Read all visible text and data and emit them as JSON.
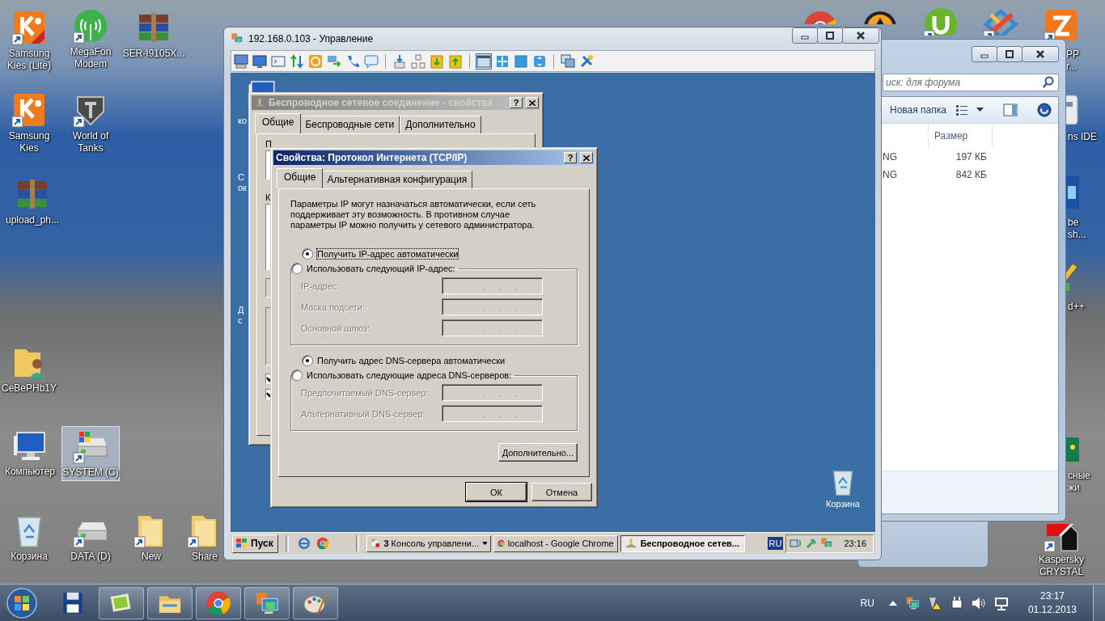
{
  "desktop_icons": [
    {
      "kind": "kies-lite",
      "label": "Samsung Kies (Lite)",
      "shortcut": true,
      "selected": false
    },
    {
      "kind": "modem",
      "label": "MegaFon Modem",
      "shortcut": true,
      "selected": false
    },
    {
      "kind": "archive",
      "label": "SER-I9105X...",
      "shortcut": false,
      "selected": false
    },
    {
      "kind": "kies",
      "label": "Samsung Kies",
      "shortcut": true,
      "selected": false
    },
    {
      "kind": "tanks",
      "label": "World of Tanks",
      "shortcut": true,
      "selected": false
    },
    {
      "kind": "archive",
      "label": "upload_ph...",
      "shortcut": false,
      "selected": false
    },
    {
      "kind": "user-folder",
      "label": "CeBePHb1Y",
      "shortcut": false,
      "selected": false
    },
    {
      "kind": "computer",
      "label": "Компьютер",
      "shortcut": false,
      "selected": false
    },
    {
      "kind": "system-drive",
      "label": "SYSTEM (C)",
      "shortcut": true,
      "selected": true
    },
    {
      "kind": "recycle-bin",
      "label": "Корзина",
      "shortcut": false,
      "selected": false
    },
    {
      "kind": "drive",
      "label": "DATA (D)",
      "shortcut": true,
      "selected": false
    },
    {
      "kind": "folder",
      "label": "New",
      "shortcut": true,
      "selected": false
    },
    {
      "kind": "folder",
      "label": "Share",
      "shortcut": true,
      "selected": false
    },
    {
      "kind": "chrome"
    },
    {
      "kind": "game"
    },
    {
      "kind": "torrent",
      "shortcut": true
    },
    {
      "kind": "studio",
      "shortcut": true
    },
    {
      "kind": "xampp",
      "label": "PP\nr...",
      "shortcut": true
    },
    {
      "kind": "ide",
      "label": "ns IDE"
    },
    {
      "kind": "photoshop",
      "label": "be\nsh..."
    },
    {
      "kind": "notepad",
      "label": "d++"
    },
    {
      "kind": "green-app",
      "label": "сные\nжи"
    },
    {
      "kind": "kaspersky",
      "label": "Kaspersky\nCRYSTAL",
      "shortcut": true,
      "selected": false
    }
  ],
  "explorer": {
    "search_placeholder": "иск: для форума",
    "new_folder": "Новая папка",
    "columns": [
      "Размер"
    ],
    "rows": [
      {
        "name": "NG",
        "size": "197 КБ"
      },
      {
        "name": "NG",
        "size": "842 КБ"
      }
    ]
  },
  "remote_window": {
    "title": "192.168.0.103 - Управление",
    "toolbar": [
      {
        "kind": "monitor-keyboard",
        "pressed": false
      },
      {
        "kind": "monitor",
        "pressed": false
      },
      {
        "kind": "terminal",
        "pressed": false
      },
      {
        "kind": "transfer",
        "pressed": false
      },
      {
        "kind": "power",
        "pressed": false
      },
      {
        "kind": "chat-arrows",
        "pressed": false
      },
      {
        "kind": "phone",
        "pressed": false
      },
      {
        "kind": "chat",
        "pressed": false
      },
      {
        "kind": "separator"
      },
      {
        "kind": "download",
        "pressed": false
      },
      {
        "kind": "network",
        "pressed": false
      },
      {
        "kind": "clipboard-down",
        "pressed": false
      },
      {
        "kind": "clipboard-up",
        "pressed": false
      },
      {
        "kind": "separator"
      },
      {
        "kind": "window",
        "pressed": true
      },
      {
        "kind": "fit",
        "pressed": false
      },
      {
        "kind": "square",
        "pressed": false
      },
      {
        "kind": "circle-arrows",
        "pressed": false
      },
      {
        "kind": "separator"
      },
      {
        "kind": "windows",
        "pressed": false
      },
      {
        "kind": "tools",
        "pressed": false
      }
    ]
  },
  "remote_desktop": {
    "icons": [
      {
        "kind": "computer",
        "label": "ко"
      },
      {
        "kind": "blank",
        "label": "С\nок"
      },
      {
        "kind": "blank",
        "label": "Д\nс"
      },
      {
        "kind": "recycle-bin",
        "label": "Корзина"
      }
    ]
  },
  "back_dialog": {
    "title": "Беспроводное сетевое соединение - свойства",
    "active": false,
    "help_button": "?",
    "tabs": [
      {
        "label": "Общие",
        "selected": true
      },
      {
        "label": "Беспроводные сети",
        "selected": false
      },
      {
        "label": "Дополнительно",
        "selected": false
      }
    ],
    "partial_labels": [
      "П",
      "К"
    ],
    "checkboxes": [
      {
        "checked": true
      },
      {
        "checked": true
      }
    ]
  },
  "tcp_dialog": {
    "title": "Свойства: Протокол Интернета (TCP/IP)",
    "active": true,
    "help_button": "?",
    "tabs": [
      {
        "label": "Общие",
        "selected": true
      },
      {
        "label": "Альтернативная конфигурация",
        "selected": false
      }
    ],
    "description": "Параметры IP могут назначаться автоматически, если сеть поддерживает эту возможность. В противном случае параметры IP можно получить у сетевого администратора.",
    "ip_mode": [
      {
        "label": "Получить IP-адрес автоматически",
        "selected": true,
        "focused": true
      },
      {
        "label": "Использовать следующий IP-адрес:",
        "selected": false,
        "focused": false
      }
    ],
    "ip_fields": [
      {
        "label": "IP-адрес:",
        "disabled": true
      },
      {
        "label": "Маска подсети:",
        "disabled": true
      },
      {
        "label": "Основной шлюз:",
        "disabled": true
      }
    ],
    "dns_mode": [
      {
        "label": "Получить адрес DNS-сервера автоматически",
        "selected": true,
        "focused": false
      },
      {
        "label": "Использовать следующие адреса DNS-серверов:",
        "selected": false,
        "focused": false
      }
    ],
    "dns_fields": [
      {
        "label": "Предпочитаемый DNS-сервер:",
        "disabled": true
      },
      {
        "label": "Альтернативный DNS-сервер:",
        "disabled": true
      }
    ],
    "advanced_button": "Дополнительно...",
    "buttons": [
      "ОК",
      "Отмена"
    ]
  },
  "remote_taskbar": {
    "start": "Пуск",
    "quick_launch": [
      {
        "kind": "ie"
      },
      {
        "kind": "chrome"
      }
    ],
    "tasks": [
      {
        "kind": "console",
        "label": "**3** Консоль управлени...",
        "group": true,
        "selected": false
      },
      {
        "kind": "chrome",
        "label": "localhost - Google Chrome",
        "group": false,
        "selected": false
      },
      {
        "kind": "network",
        "label": "Беспроводное сетев...",
        "group": false,
        "selected": true
      }
    ],
    "language": "RU",
    "clock": "23:16"
  },
  "taskbar": {
    "pinned": [
      {
        "kind": "floppy",
        "running": false
      },
      {
        "kind": "photos",
        "running": true
      },
      {
        "kind": "explorer",
        "running": true
      },
      {
        "kind": "chrome",
        "running": true
      },
      {
        "kind": "remote-admin",
        "running": true
      },
      {
        "kind": "paint",
        "running": true
      }
    ],
    "language": "RU",
    "time": "23:17",
    "date": "01.12.2013"
  }
}
